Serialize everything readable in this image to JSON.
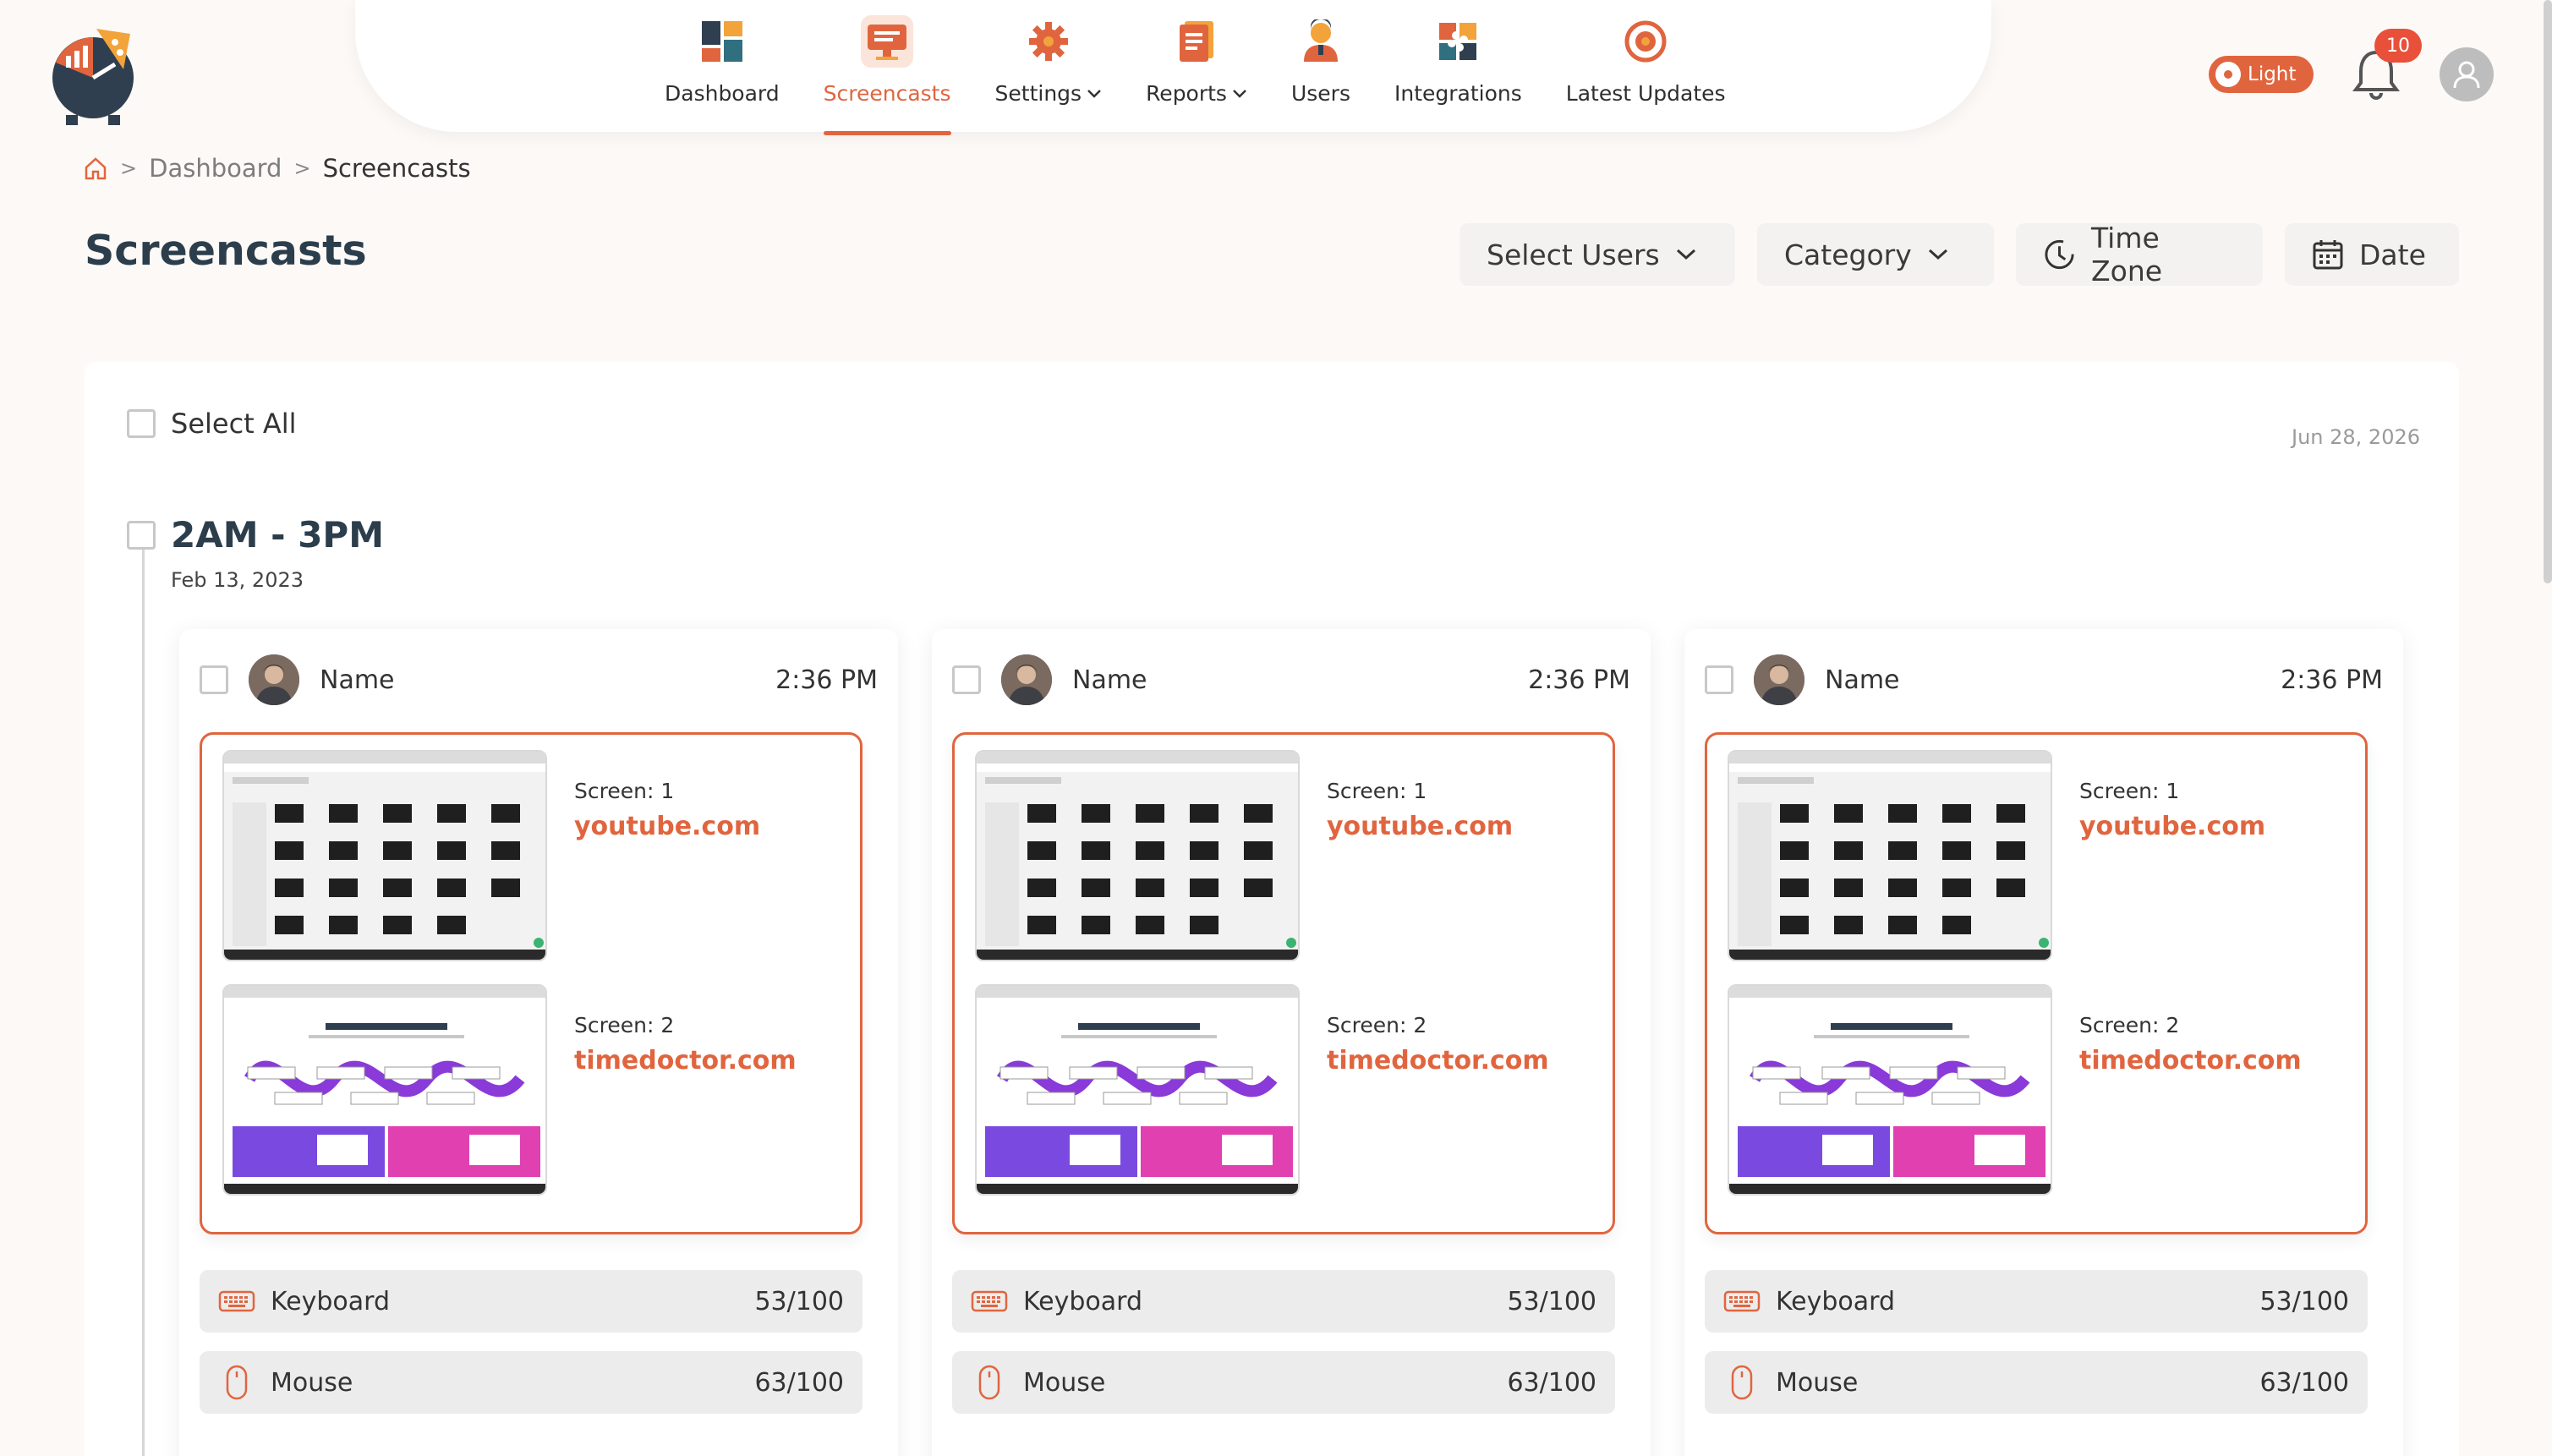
{
  "nav": {
    "items": [
      {
        "label": "Dashboard",
        "icon": "dashboard-icon",
        "caret": ""
      },
      {
        "label": "Screencasts",
        "icon": "monitor-icon",
        "caret": "",
        "active": true
      },
      {
        "label": "Settings",
        "icon": "gear-icon",
        "caret": "⌵"
      },
      {
        "label": "Reports",
        "icon": "report-icon",
        "caret": "⌵"
      },
      {
        "label": "Users",
        "icon": "user-icon",
        "caret": ""
      },
      {
        "label": "Integrations",
        "icon": "puzzle-icon",
        "caret": ""
      },
      {
        "label": "Latest Updates",
        "icon": "updates-icon",
        "caret": ""
      }
    ]
  },
  "theme": {
    "label": "Light"
  },
  "notifications": {
    "count": "10"
  },
  "breadcrumb": {
    "home_icon": "home-icon",
    "dashboard": "Dashboard",
    "current": "Screencasts",
    "sep": ">"
  },
  "page": {
    "title": "Screencasts"
  },
  "filters": {
    "select_users": "Select Users",
    "category": "Category",
    "time_zone": "Time Zone",
    "date": "Date"
  },
  "content": {
    "select_all": "Select All",
    "top_date": "Jun 28, 2026",
    "group": {
      "title": "2AM - 3PM",
      "date": "Feb 13, 2023"
    }
  },
  "cards": [
    {
      "name": "Name",
      "time": "2:36 PM",
      "screens": [
        {
          "label": "Screen: 1",
          "site": "youtube.com"
        },
        {
          "label": "Screen: 2",
          "site": "timedoctor.com"
        }
      ],
      "keyboard": {
        "label": "Keyboard",
        "value": "53/100"
      },
      "mouse": {
        "label": "Mouse",
        "value": "63/100"
      }
    },
    {
      "name": "Name",
      "time": "2:36 PM",
      "screens": [
        {
          "label": "Screen: 1",
          "site": "youtube.com"
        },
        {
          "label": "Screen: 2",
          "site": "timedoctor.com"
        }
      ],
      "keyboard": {
        "label": "Keyboard",
        "value": "53/100"
      },
      "mouse": {
        "label": "Mouse",
        "value": "63/100"
      }
    },
    {
      "name": "Name",
      "time": "2:36 PM",
      "screens": [
        {
          "label": "Screen: 1",
          "site": "youtube.com"
        },
        {
          "label": "Screen: 2",
          "site": "timedoctor.com"
        }
      ],
      "keyboard": {
        "label": "Keyboard",
        "value": "53/100"
      },
      "mouse": {
        "label": "Mouse",
        "value": "63/100"
      }
    }
  ],
  "colors": {
    "accent": "#e0653f",
    "title": "#2c3e4c",
    "background": "#fdf9f7"
  }
}
